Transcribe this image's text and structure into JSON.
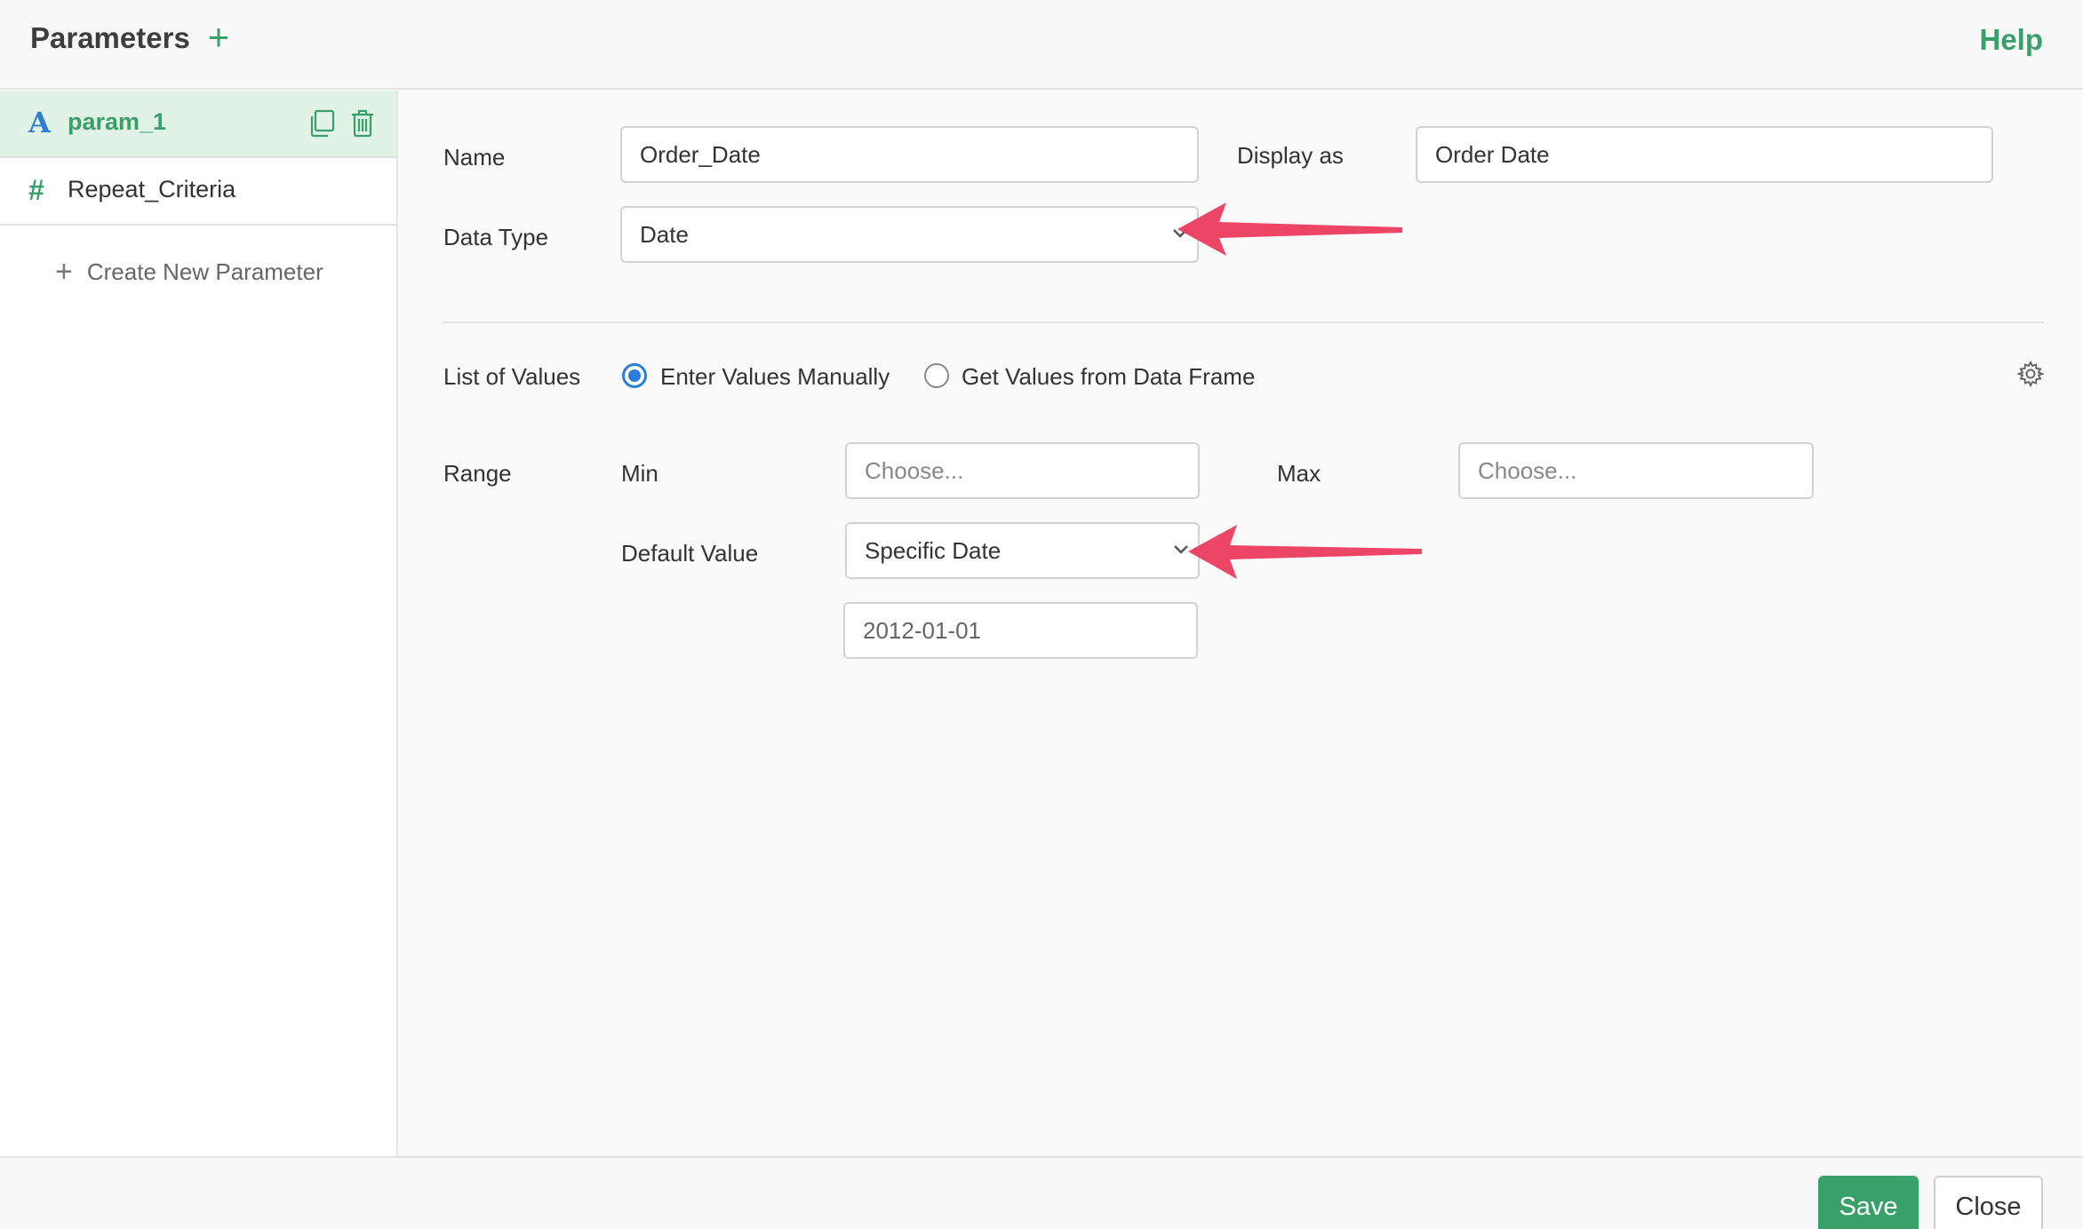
{
  "header": {
    "title": "Parameters",
    "add_icon": "plus-icon",
    "help_label": "Help"
  },
  "sidebar": {
    "items": [
      {
        "label": "param_1",
        "type_glyph": "A",
        "type_icon": "text-type-icon",
        "active": true
      },
      {
        "label": "Repeat_Criteria",
        "type_glyph": "#",
        "type_icon": "number-type-icon",
        "active": false
      }
    ],
    "create_new_label": "Create New Parameter"
  },
  "form": {
    "name_label": "Name",
    "name_value": "Order_Date",
    "display_label": "Display as",
    "display_value": "Order Date",
    "data_type_label": "Data Type",
    "data_type_value": "Date",
    "list_of_values_label": "List of Values",
    "radio_manual_label": "Enter Values Manually",
    "radio_dataframe_label": "Get Values from Data Frame",
    "radio_selected": "manual",
    "range_label": "Range",
    "min_label": "Min",
    "min_placeholder": "Choose...",
    "max_label": "Max",
    "max_placeholder": "Choose...",
    "default_value_label": "Default Value",
    "default_value_type": "Specific Date",
    "default_date_value": "2012-01-01"
  },
  "footer": {
    "save_label": "Save",
    "close_label": "Close"
  },
  "colors": {
    "accent_green": "#3aa06a",
    "active_row_bg": "#e1f3e6",
    "radio_blue": "#2a7ddc",
    "annotation_arrow": "#ec4566"
  }
}
